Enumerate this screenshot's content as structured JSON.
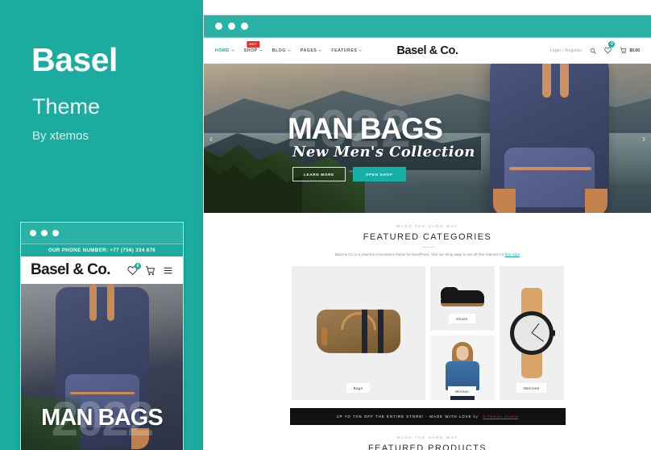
{
  "theme": {
    "accent": "#1cab9f",
    "dark": "#111111",
    "red": "#e2322c",
    "title": "Basel",
    "subtitle": "Theme",
    "author": "By xtemos"
  },
  "mobile": {
    "phone_bar": "OUR PHONE NUMBER: +77 (756) 334 876",
    "logo": "Basel & Co.",
    "logo_dot": ".",
    "wishlist_count": "0",
    "cart_count": "0",
    "icons": {
      "wishlist": "heart-icon",
      "cart": "cart-icon",
      "menu": "hamburger-menu-icon"
    },
    "hero": {
      "year_watermark": "2022",
      "title": "MAN BAGS"
    }
  },
  "desktop": {
    "nav": [
      {
        "label": "HOME",
        "active": true,
        "caret": true,
        "badge": ""
      },
      {
        "label": "SHOP",
        "active": false,
        "caret": true,
        "badge": "HOT"
      },
      {
        "label": "BLOG",
        "active": false,
        "caret": true,
        "badge": ""
      },
      {
        "label": "PAGES",
        "active": false,
        "caret": true,
        "badge": ""
      },
      {
        "label": "FEATURES",
        "active": false,
        "caret": true,
        "badge": ""
      }
    ],
    "logo": "Basel & Co.",
    "account_link": "Login / Register",
    "search_icon": "search-icon",
    "wishlist_icon": "heart-icon",
    "wishlist_count": "0",
    "cart_icon": "cart-icon",
    "cart_total": "$0.00",
    "hero": {
      "year_watermark": "2022",
      "title": "MAN BAGS",
      "subtitle": "New Men's Collection",
      "btn_primary": "LEARN MORE",
      "btn_secondary": "OPEN SHOP",
      "arrow_prev": "chevron-left-icon",
      "arrow_next": "chevron-right-icon"
    },
    "featured_categories": {
      "eyebrow": "MADE THE HARD WAY",
      "title": "FEATURED CATEGORIES",
      "description_part1": "Basel & Co. is a powerful eCommerce theme for WordPress. Visit our",
      "description_part2": "Shop page to see all their features for",
      "description_link": "free store",
      "tiles": [
        {
          "label": "Bags"
        },
        {
          "label": "Shoes"
        },
        {
          "label": "Woman"
        },
        {
          "label": "Watches"
        }
      ]
    },
    "promo_banner": {
      "text": "UP TO 70% OFF THE ENTIRE STORE! - MADE WITH LOVE",
      "by": "by",
      "link": "X-Temos studio"
    },
    "featured_products": {
      "eyebrow": "MADE THE HARD WAY",
      "title": "FEATURED PRODUCTS"
    }
  }
}
